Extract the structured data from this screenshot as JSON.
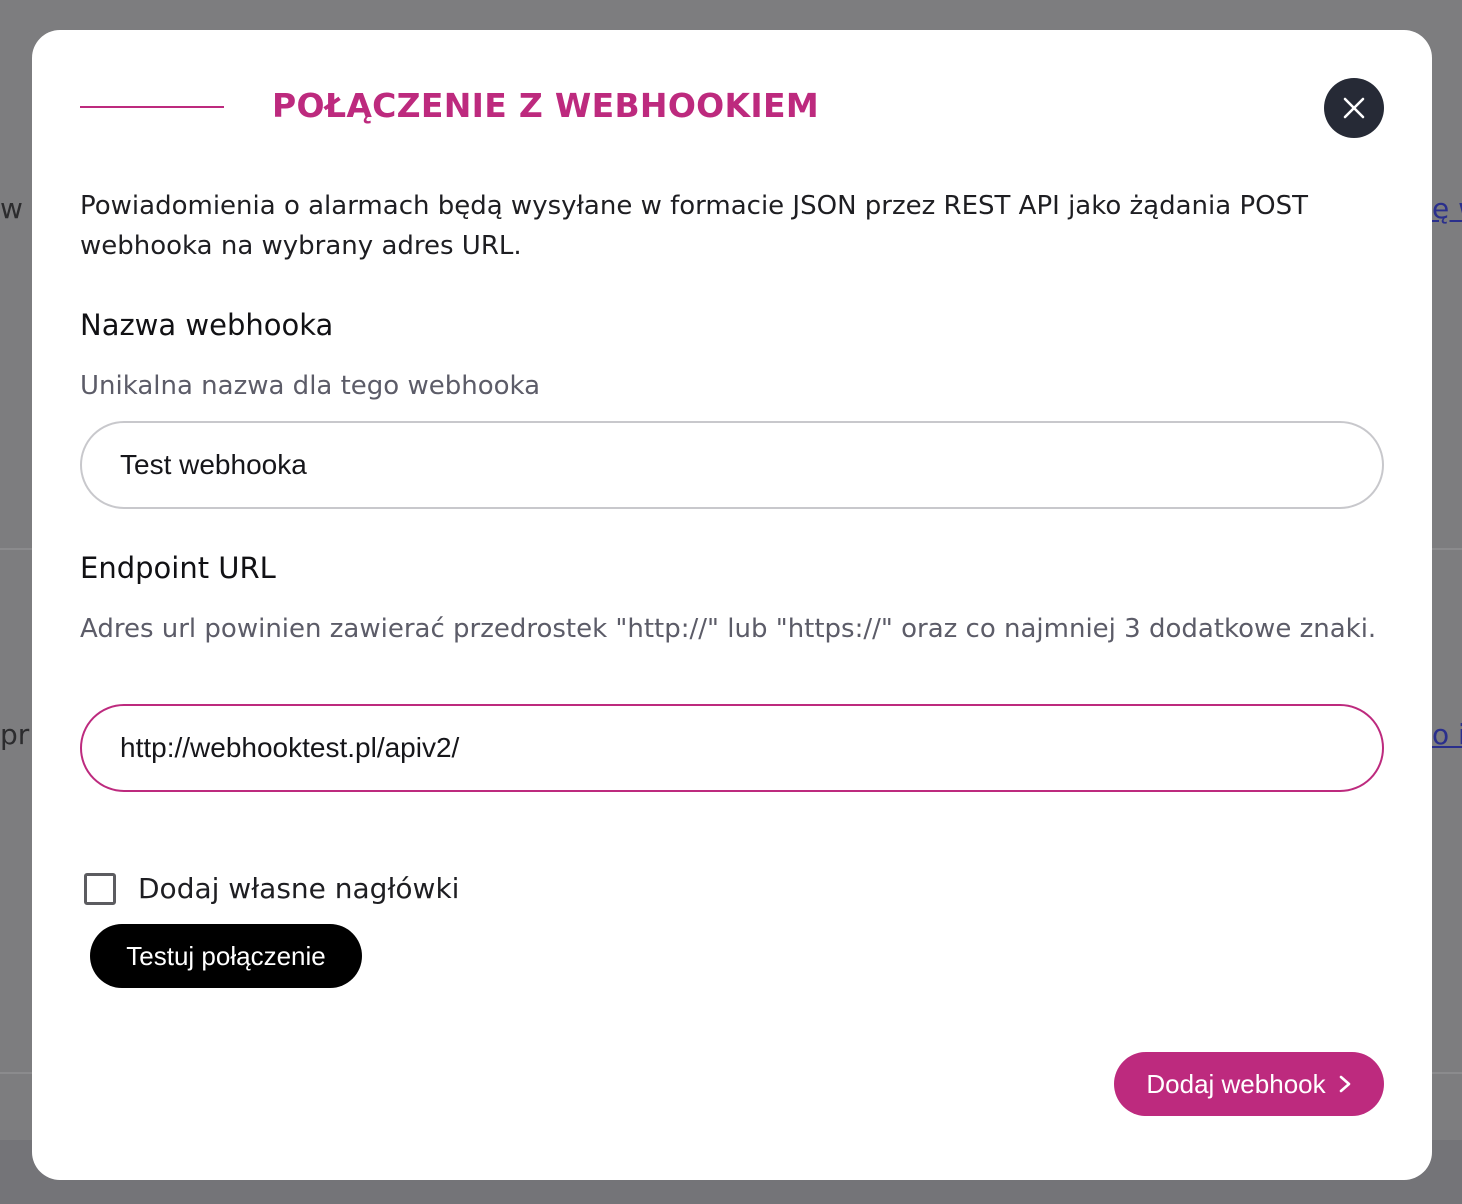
{
  "background": {
    "left_fragment_top": "w",
    "left_fragment_mid": "pr",
    "right_link_top": "ę w",
    "right_link_mid": "o i"
  },
  "modal": {
    "title": "POŁĄCZENIE Z WEBHOOKIEM",
    "close_icon": "close-icon",
    "intro": "Powiadomienia o alarmach będą wysyłane w formacie JSON przez REST API jako żądania POST webhooka na wybrany adres URL.",
    "name_field": {
      "label": "Nazwa webhooka",
      "hint": "Unikalna nazwa dla tego webhooka",
      "value": "Test webhooka"
    },
    "url_field": {
      "label": "Endpoint URL",
      "hint": "Adres url powinien zawierać przedrostek \"http://\" lub \"https://\" oraz co najmniej 3 dodatkowe znaki.",
      "value": "http://webhooktest.pl/apiv2/"
    },
    "custom_headers": {
      "label": "Dodaj własne nagłówki",
      "checked": false
    },
    "test_button": "Testuj połączenie",
    "add_button": "Dodaj webhook",
    "add_button_icon": "chevron-right-icon"
  },
  "colors": {
    "accent": "#bd2a7e",
    "close_bg": "#262a36",
    "overlay": "#7d7d7f"
  }
}
